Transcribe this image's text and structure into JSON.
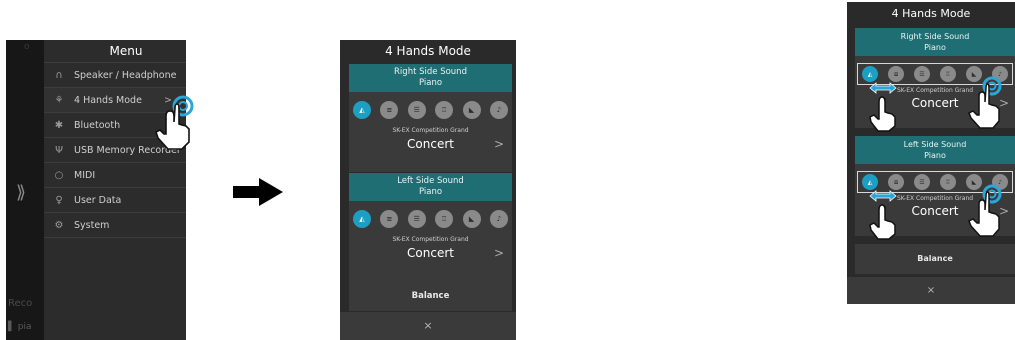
{
  "menu_panel": {
    "title": "Menu",
    "background_fragments": [
      "Reco",
      "▌ pia"
    ],
    "left_chevron": "⟫",
    "items": [
      {
        "icon": "headphone-icon",
        "glyph": "∩",
        "label": "Speaker / Headphone"
      },
      {
        "icon": "four-hands-icon",
        "glyph": "⚘",
        "label": "4 Hands Mode",
        "chevron": ">"
      },
      {
        "icon": "bluetooth-icon",
        "glyph": "✱",
        "label": "Bluetooth"
      },
      {
        "icon": "usb-icon",
        "glyph": "Ψ",
        "label": "USB Memory Recorder"
      },
      {
        "icon": "midi-icon",
        "glyph": "○",
        "label": "MIDI"
      },
      {
        "icon": "user-data-icon",
        "glyph": "♀",
        "label": "User Data"
      },
      {
        "icon": "system-icon",
        "glyph": "⚙",
        "label": "System"
      }
    ]
  },
  "mode_panel": {
    "title": "4 Hands Mode",
    "right_section": {
      "title": "Right Side Sound",
      "subtitle": "Piano"
    },
    "left_section": {
      "title": "Left Side Sound",
      "subtitle": "Piano"
    },
    "category_icons": [
      {
        "name": "grand-piano-icon",
        "glyph": "◭",
        "active": true
      },
      {
        "name": "electric-piano-icon",
        "glyph": "≡",
        "active": false
      },
      {
        "name": "organ-icon",
        "glyph": "☰",
        "active": false
      },
      {
        "name": "strings-icon",
        "glyph": "♖",
        "active": false
      },
      {
        "name": "harpsichord-icon",
        "glyph": "◣",
        "active": false
      },
      {
        "name": "other-sounds-icon",
        "glyph": "♪",
        "active": false
      }
    ],
    "sound_subtitle": "SK-EX Competition Grand",
    "sound_name": "Concert",
    "sound_chevron": ">",
    "balance_label": "Balance",
    "close_label": "×"
  },
  "colors": {
    "teal_header": "#1f6e73",
    "active_icon": "#1c9fc2",
    "arrow": "#000000",
    "hand_ring": "#2aa7d8"
  }
}
